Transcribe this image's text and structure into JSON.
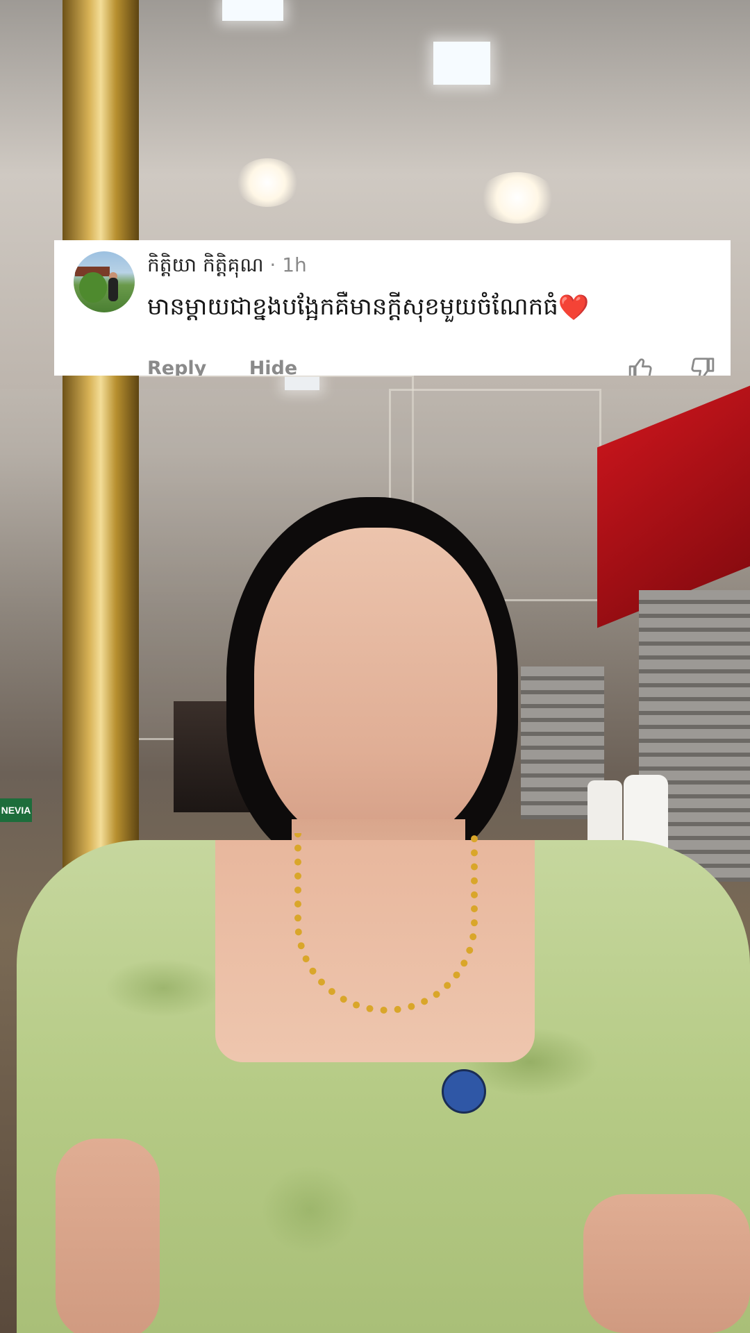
{
  "comment": {
    "username": "កិត្តិយា កិត្តិគុណ",
    "separator": "·",
    "timestamp": "1h",
    "text": "មានម្តាយជាខ្នងបង្អែកគឺមានក្តីសុខមួយចំណែកធំ",
    "emoji": "❤️",
    "reply_label": "Reply",
    "hide_label": "Hide",
    "like_icon": "thumbs-up-icon",
    "dislike_icon": "thumbs-down-icon"
  },
  "background": {
    "sign_text": "NEVIA"
  }
}
